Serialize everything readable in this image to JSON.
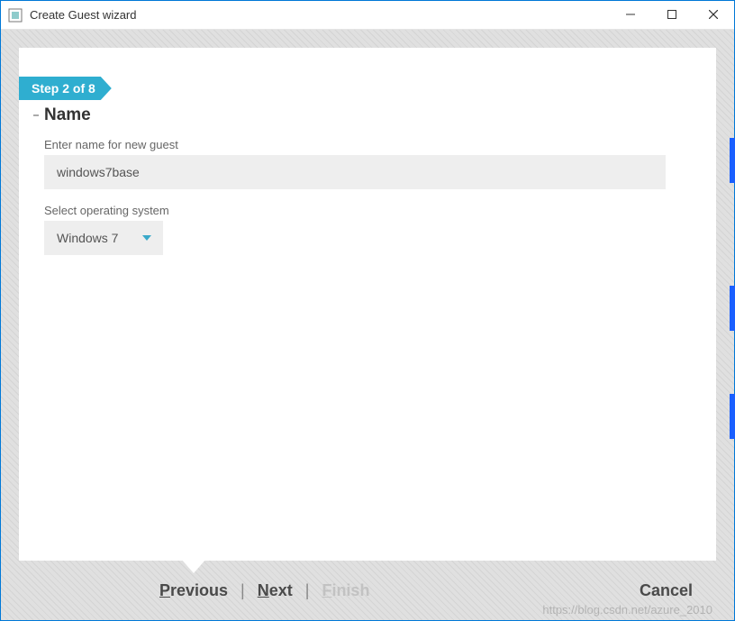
{
  "window": {
    "title": "Create Guest wizard"
  },
  "wizard": {
    "step_label": "Step 2 of 8",
    "section_title": "Name",
    "name_label": "Enter name for new guest",
    "name_value": "windows7base",
    "os_label": "Select operating system",
    "os_value": "Windows 7"
  },
  "footer": {
    "previous": "Previous",
    "next": "Next",
    "finish": "Finish",
    "cancel": "Cancel"
  },
  "watermark": "https://blog.csdn.net/azure_2010"
}
